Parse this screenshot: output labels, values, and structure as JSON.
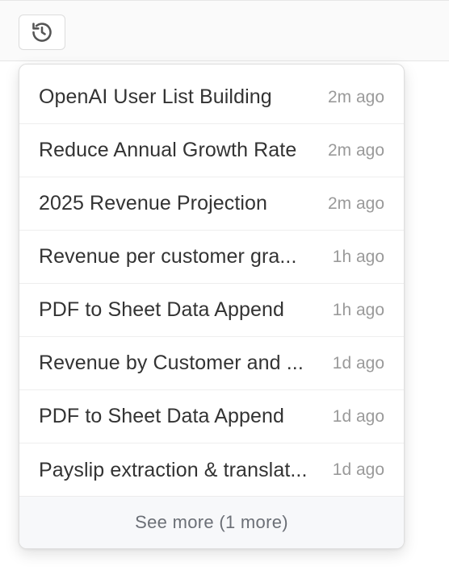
{
  "toolbar": {
    "history_icon": "history-icon"
  },
  "history_menu": {
    "items": [
      {
        "title": "OpenAI User List Building",
        "time": "2m ago"
      },
      {
        "title": "Reduce Annual Growth Rate",
        "time": "2m ago"
      },
      {
        "title": "2025 Revenue Projection",
        "time": "2m ago"
      },
      {
        "title": "Revenue per customer gra...",
        "time": "1h ago"
      },
      {
        "title": "PDF to Sheet Data Append",
        "time": "1h ago"
      },
      {
        "title": "Revenue by Customer and ...",
        "time": "1d ago"
      },
      {
        "title": "PDF to Sheet Data Append",
        "time": "1d ago"
      },
      {
        "title": "Payslip extraction & translat...",
        "time": "1d ago"
      }
    ],
    "see_more_label": "See more (1 more)"
  }
}
